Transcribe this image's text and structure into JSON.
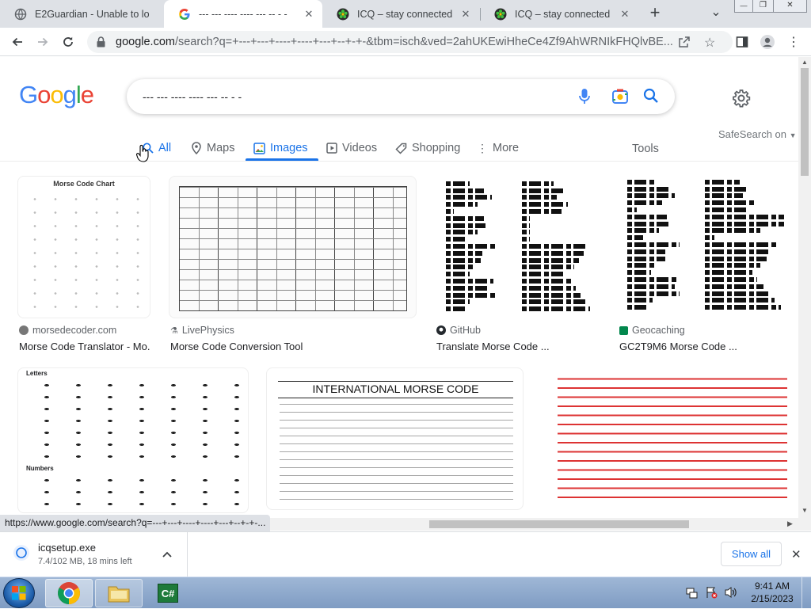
{
  "browser": {
    "tabs": [
      {
        "title": "E2Guardian - Unable to lo",
        "active": false
      },
      {
        "title": "--- --- ---- ---- --- -- - -",
        "active": true
      },
      {
        "title": "ICQ – stay connected",
        "active": false
      },
      {
        "title": "ICQ – stay connected",
        "active": false
      }
    ],
    "new_tab": "+",
    "tab_list": "⌄",
    "window": {
      "minimize": "—",
      "restore": "❐",
      "close": "✕"
    },
    "url_host": "google.com",
    "url_rest": "/search?q=+---+---+----+----+---+--+-+-&tbm=isch&ved=2ahUKEwiHheCe4Zf9AhWRNIkFHQlvBE..."
  },
  "google": {
    "search_value": "--- --- ---- ---- --- -- - -",
    "nav": {
      "all": "All",
      "maps": "Maps",
      "images": "Images",
      "videos": "Videos",
      "shopping": "Shopping",
      "more": "More",
      "tools": "Tools",
      "safesearch": "SafeSearch on"
    },
    "results_row1": [
      {
        "source": "morsedecoder.com",
        "caption": "Morse Code Translator - Mo...",
        "thumb_title": "Morse Code Chart"
      },
      {
        "source": "LivePhysics",
        "caption": "Morse Code Conversion Tool"
      },
      {
        "source": "GitHub",
        "caption": "Translate Morse Code ..."
      },
      {
        "source": "Geocaching",
        "caption": "GC2T9M6 Morse Code ..."
      }
    ],
    "results_row2": [
      {
        "thumb_title_letters": "Letters",
        "thumb_title_numbers": "Numbers"
      },
      {
        "thumb_title": "INTERNATIONAL MORSE CODE"
      },
      {}
    ]
  },
  "status_url": "https://www.google.com/search?q=---+---+----+----+---+--+-+-...",
  "downloads": {
    "file_name": "icqsetup.exe",
    "progress": "7.4/102 MB, 18 mins left",
    "show_all": "Show all"
  },
  "taskbar": {
    "time": "9:41 AM",
    "date": "2/15/2023"
  },
  "colors": {
    "accent": "#1a73e8",
    "tab_strip": "#dee1e6"
  }
}
